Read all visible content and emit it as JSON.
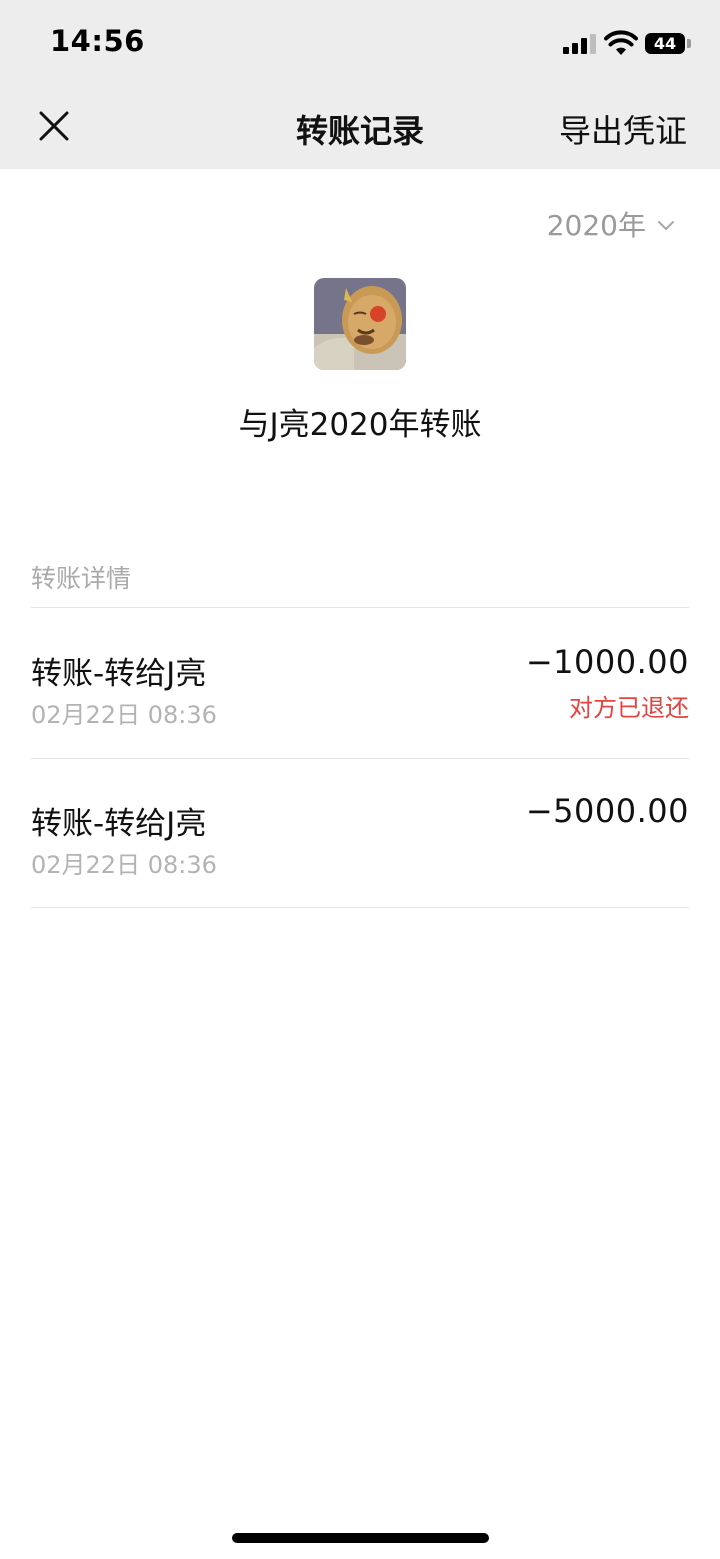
{
  "status_bar": {
    "time": "14:56",
    "battery": "44"
  },
  "nav": {
    "title": "转账记录",
    "export_label": "导出凭证"
  },
  "year_filter": {
    "selected": "2020年"
  },
  "peer": {
    "title": "与J亮2020年转账"
  },
  "section": {
    "label": "转账详情"
  },
  "transactions": [
    {
      "title": "转账-转给J亮",
      "time": "02月22日 08:36",
      "amount": "−1000.00",
      "status": "对方已退还"
    },
    {
      "title": "转账-转给J亮",
      "time": "02月22日 08:36",
      "amount": "−5000.00"
    }
  ],
  "colors": {
    "header_bg": "#ededed",
    "refund_status": "#e64340",
    "secondary_text": "#b3b3b3"
  }
}
